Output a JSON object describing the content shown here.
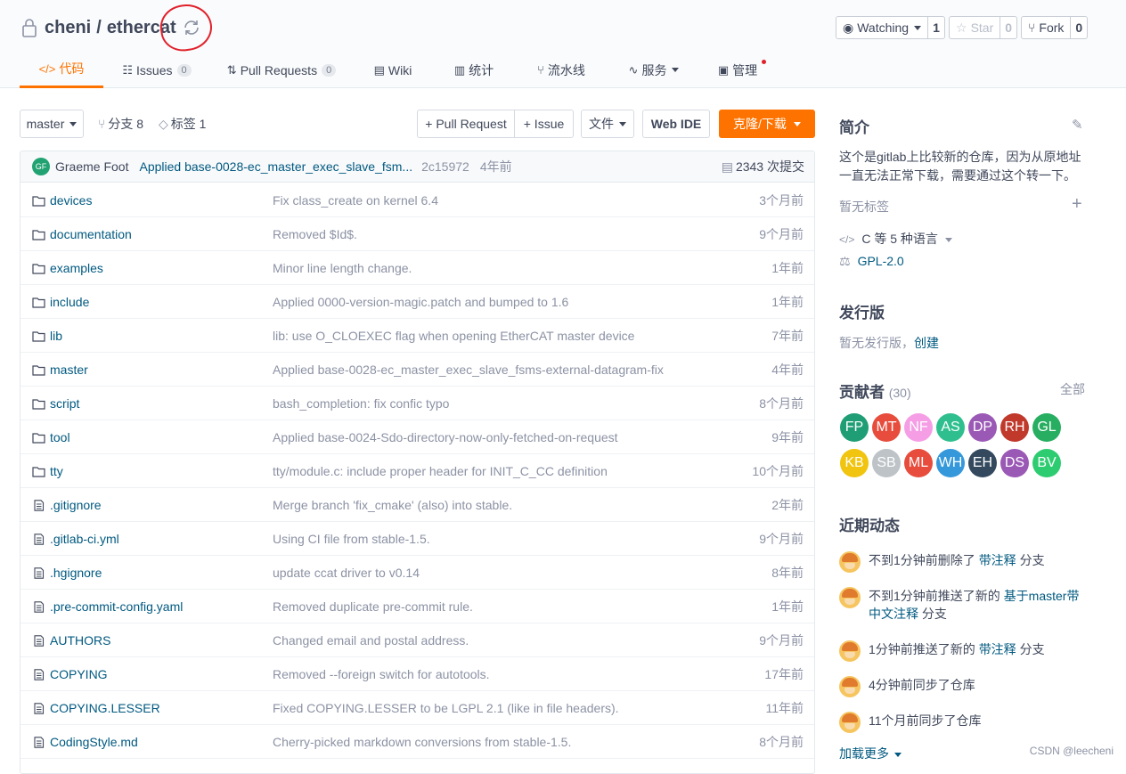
{
  "repo": {
    "owner": "cheni",
    "separator": "/",
    "name": "ethercat"
  },
  "header_buttons": {
    "watch": {
      "label": "Watching",
      "count": "1"
    },
    "star": {
      "label": "Star",
      "count": "0"
    },
    "fork": {
      "label": "Fork",
      "count": "0"
    }
  },
  "nav": [
    {
      "label": "代码",
      "icon": "code-icon"
    },
    {
      "label": "Issues",
      "icon": "issues-icon",
      "badge": "0"
    },
    {
      "label": "Pull Requests",
      "icon": "pull-request-icon",
      "badge": "0"
    },
    {
      "label": "Wiki",
      "icon": "wiki-icon"
    },
    {
      "label": "统计",
      "icon": "stats-icon"
    },
    {
      "label": "流水线",
      "icon": "pipeline-icon"
    },
    {
      "label": "服务",
      "icon": "service-icon"
    },
    {
      "label": "管理",
      "icon": "manage-icon"
    }
  ],
  "toolbar": {
    "branch": "master",
    "branches": "分支 8",
    "tags": "标签 1",
    "pull_request": "+ Pull Request",
    "issue": "+ Issue",
    "file": "文件",
    "web_ide": "Web IDE",
    "clone": "克隆/下载"
  },
  "last_commit": {
    "avatar": "GF",
    "author": "Graeme Foot",
    "message": "Applied base-0028-ec_master_exec_slave_fsm...",
    "hash": "2c15972",
    "time": "4年前",
    "total": "2343 次提交"
  },
  "files": [
    {
      "name": "devices",
      "type": "folder",
      "message": "Fix class_create on kernel 6.4",
      "time": "3个月前"
    },
    {
      "name": "documentation",
      "type": "folder",
      "message": "Removed $Id$.",
      "time": "9个月前"
    },
    {
      "name": "examples",
      "type": "folder",
      "message": "Minor line length change.",
      "time": "1年前"
    },
    {
      "name": "include",
      "type": "folder",
      "message": "Applied 0000-version-magic.patch and bumped to 1.6",
      "time": "1年前"
    },
    {
      "name": "lib",
      "type": "folder",
      "message": "lib: use O_CLOEXEC flag when opening EtherCAT master device",
      "time": "7年前"
    },
    {
      "name": "master",
      "type": "folder",
      "message": "Applied base-0028-ec_master_exec_slave_fsms-external-datagram-fix",
      "time": "4年前"
    },
    {
      "name": "script",
      "type": "folder",
      "message": "bash_completion: fix confic typo",
      "time": "8个月前"
    },
    {
      "name": "tool",
      "type": "folder",
      "message": "Applied base-0024-Sdo-directory-now-only-fetched-on-request",
      "time": "9年前"
    },
    {
      "name": "tty",
      "type": "folder",
      "message": "tty/module.c: include proper header for INIT_C_CC definition",
      "time": "10个月前"
    },
    {
      "name": ".gitignore",
      "type": "file",
      "message": "Merge branch 'fix_cmake' (also) into stable.",
      "time": "2年前"
    },
    {
      "name": ".gitlab-ci.yml",
      "type": "file",
      "message": "Using CI file from stable-1.5.",
      "time": "9个月前"
    },
    {
      "name": ".hgignore",
      "type": "file",
      "message": "update ccat driver to v0.14",
      "time": "8年前"
    },
    {
      "name": ".pre-commit-config.yaml",
      "type": "file",
      "message": "Removed duplicate pre-commit rule.",
      "time": "1年前"
    },
    {
      "name": "AUTHORS",
      "type": "file",
      "message": "Changed email and postal address.",
      "time": "9个月前"
    },
    {
      "name": "COPYING",
      "type": "file",
      "message": "Removed --foreign switch for autotools.",
      "time": "17年前"
    },
    {
      "name": "COPYING.LESSER",
      "type": "file",
      "message": "Fixed COPYING.LESSER to be LGPL 2.1 (like in file headers).",
      "time": "11年前"
    },
    {
      "name": "CodingStyle.md",
      "type": "file",
      "message": "Cherry-picked markdown conversions from stable-1.5.",
      "time": "8个月前"
    }
  ],
  "sidebar": {
    "intro_title": "简介",
    "intro_line1": "这个是gitlab上比较新的仓库，因为从原地址",
    "intro_line2": "一直无法正常下载，需要通过这个转一下。",
    "no_tags": "暂无标签",
    "language": "C 等 5 种语言",
    "license": "GPL-2.0",
    "release_title": "发行版",
    "no_release": "暂无发行版，",
    "create": "创建",
    "contrib_title": "贡献者",
    "contrib_count": "(30)",
    "all": "全部",
    "contributors": [
      {
        "initials": "FP",
        "color": "#1f9e75"
      },
      {
        "initials": "MT",
        "color": "#e74c3c"
      },
      {
        "initials": "NF",
        "color": "#f59ee6"
      },
      {
        "initials": "AS",
        "color": "#2fbf8f"
      },
      {
        "initials": "DP",
        "color": "#9b59b6"
      },
      {
        "initials": "RH",
        "color": "#c0392b"
      },
      {
        "initials": "GL",
        "color": "#27ae60"
      },
      {
        "initials": "KB",
        "color": "#f1c40f"
      },
      {
        "initials": "SB",
        "color": "#bdc3c7"
      },
      {
        "initials": "ML",
        "color": "#e74c3c"
      },
      {
        "initials": "WH",
        "color": "#3498db"
      },
      {
        "initials": "EH",
        "color": "#34495e"
      },
      {
        "initials": "DS",
        "color": "#9b59b6"
      },
      {
        "initials": "BV",
        "color": "#2ecc71"
      }
    ],
    "activity_title": "近期动态",
    "activities": [
      {
        "before": "不到1分钟前删除了 ",
        "link": "带注释",
        "after": " 分支"
      },
      {
        "before": "不到1分钟前推送了新的 ",
        "link": "基于master带中文注释",
        "after": " 分支"
      },
      {
        "before": "1分钟前推送了新的 ",
        "link": "带注释",
        "after": " 分支"
      },
      {
        "before": "4分钟前同步了仓库",
        "link": "",
        "after": ""
      },
      {
        "before": "11个月前同步了仓库",
        "link": "",
        "after": ""
      }
    ],
    "load_more": "加载更多"
  },
  "watermark": "CSDN @leecheni"
}
